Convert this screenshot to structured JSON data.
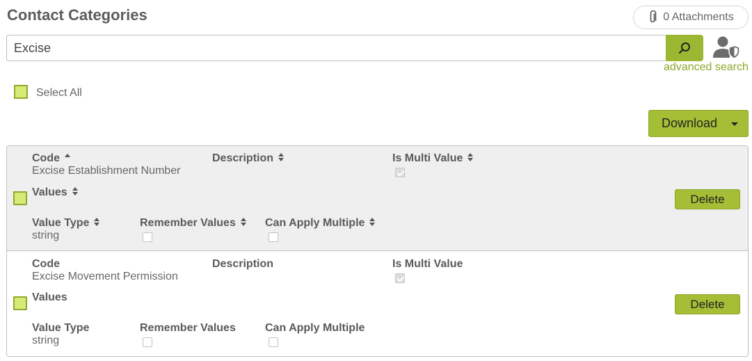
{
  "page": {
    "title": "Contact Categories"
  },
  "attachments": {
    "label": "0 Attachments"
  },
  "search": {
    "value": "Excise",
    "advanced_label": "advanced search"
  },
  "select_all": {
    "label": "Select All"
  },
  "download": {
    "label": "Download"
  },
  "columns": {
    "code": "Code",
    "description": "Description",
    "is_multi_value": "Is Multi Value",
    "values": "Values",
    "value_type": "Value Type",
    "remember_values": "Remember Values",
    "can_apply_multiple": "Can Apply Multiple"
  },
  "rows": [
    {
      "code": "Excise Establishment Number",
      "description": "",
      "is_multi_value": true,
      "values": "",
      "value_type": "string",
      "remember_values": false,
      "can_apply_multiple": false,
      "delete_label": "Delete"
    },
    {
      "code": "Excise Movement Permission",
      "description": "",
      "is_multi_value": true,
      "values": "",
      "value_type": "string",
      "remember_values": false,
      "can_apply_multiple": false,
      "delete_label": "Delete"
    }
  ],
  "colors": {
    "accent": "#a4bf35",
    "accent_dark": "#8ca52a",
    "checkbox_fill": "#d4ec76",
    "link": "#8aa82a",
    "row_alt": "#efefef"
  },
  "icons": {
    "attachment": "paperclip-icon",
    "search": "search-icon",
    "advanced": "user-shield-icon",
    "sort_asc": "sort-asc-icon",
    "sort": "sort-icon",
    "dropdown": "caret-down-icon"
  }
}
